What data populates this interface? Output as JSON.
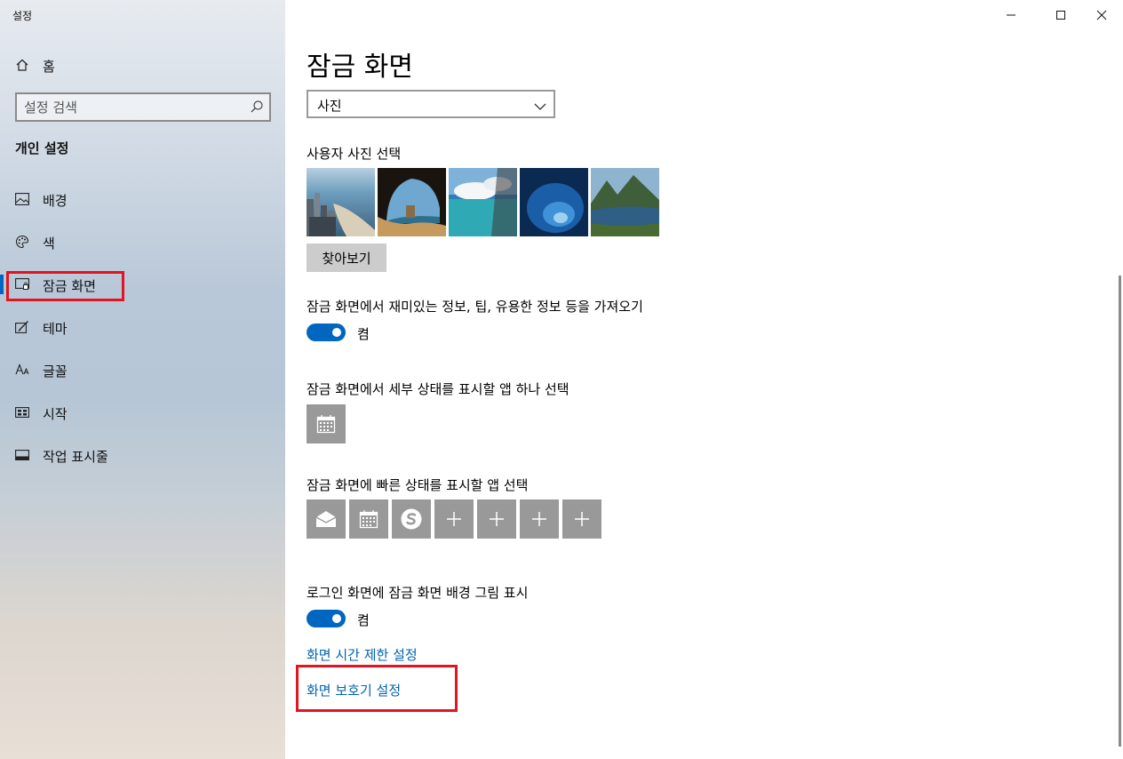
{
  "window": {
    "title": "설정"
  },
  "sidebar": {
    "home_label": "홈",
    "search_placeholder": "설정 검색",
    "section_title": "개인 설정",
    "items": [
      {
        "label": "배경",
        "icon": "image-icon"
      },
      {
        "label": "색",
        "icon": "palette-icon"
      },
      {
        "label": "잠금 화면",
        "icon": "lock-screen-icon",
        "active": true
      },
      {
        "label": "테마",
        "icon": "theme-brush-icon"
      },
      {
        "label": "글꼴",
        "icon": "font-icon"
      },
      {
        "label": "시작",
        "icon": "start-icon"
      },
      {
        "label": "작업 표시줄",
        "icon": "taskbar-icon"
      }
    ]
  },
  "main": {
    "title": "잠금 화면",
    "background_select": {
      "value": "사진"
    },
    "choose_photo_label": "사용자 사진 선택",
    "browse_label": "찾아보기",
    "fun_facts_label": "잠금 화면에서 재미있는 정보, 팁, 유용한 정보 등을 가져오기",
    "fun_facts_state": "켬",
    "detailed_status_label": "잠금 화면에서 세부 상태를 표시할 앱 하나 선택",
    "quick_status_label": "잠금 화면에 빠른 상태를 표시할 앱 선택",
    "signin_bg_label": "로그인 화면에 잠금 화면 배경 그림 표시",
    "signin_bg_state": "켬",
    "links": {
      "timeout": "화면 시간 제한 설정",
      "screensaver": "화면 보호기 설정"
    }
  },
  "colors": {
    "accent": "#0067c0",
    "link": "#0063b1",
    "highlight": "#e3131f",
    "tile": "#999999"
  }
}
